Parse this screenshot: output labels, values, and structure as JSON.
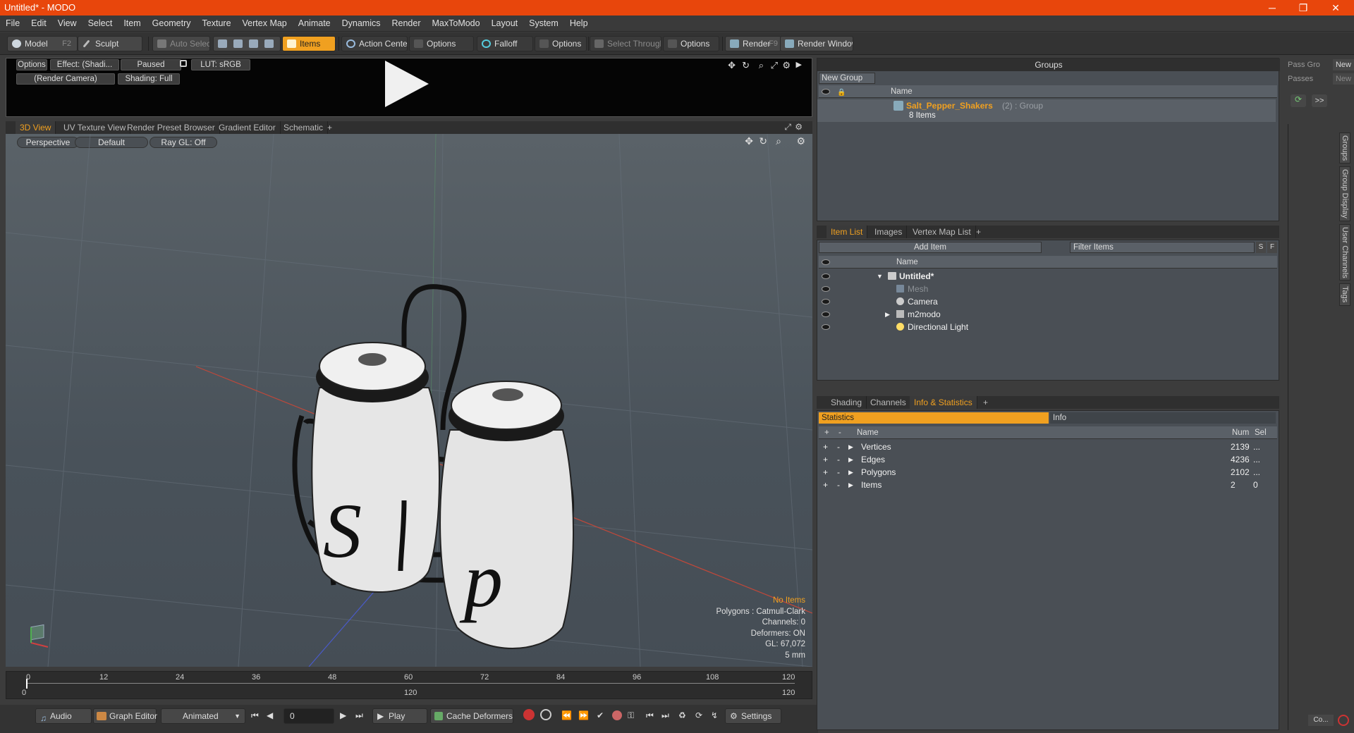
{
  "window": {
    "title": "Untitled* - MODO",
    "min": "─",
    "max": "❐",
    "close": "✕"
  },
  "menu": [
    "File",
    "Edit",
    "View",
    "Select",
    "Item",
    "Geometry",
    "Texture",
    "Vertex Map",
    "Animate",
    "Dynamics",
    "Render",
    "MaxToModo",
    "Layout",
    "System",
    "Help"
  ],
  "toolbar": {
    "model": "Model",
    "model_key": "F2",
    "sculpt": "Sculpt",
    "auto_select": "Auto Select",
    "items": "Items",
    "action_center": "Action Center",
    "options1": "Options",
    "falloff": "Falloff",
    "options2": "Options",
    "select_through": "Select Through",
    "options3": "Options",
    "render": "Render",
    "render_key": "F9",
    "render_window": "Render Window"
  },
  "preview": {
    "options": "Options",
    "effect": "Effect: (Shadi...",
    "paused": "Paused",
    "lut": "LUT: sRGB",
    "camera": "(Render Camera)",
    "shading": "Shading: Full"
  },
  "view_tabs": [
    "3D View",
    "UV Texture View",
    "Render Preset Browser",
    "Gradient Editor",
    "Schematic",
    "+"
  ],
  "viewport": {
    "perspective": "Perspective",
    "default": "Default",
    "raygl": "Ray GL: Off",
    "info": {
      "no_items": "No Items",
      "polygons": "Polygons : Catmull-Clark",
      "channels": "Channels: 0",
      "deformers": "Deformers: ON",
      "gl": "GL: 67,072",
      "unit": "5 mm"
    },
    "shaker_s": "S",
    "shaker_p": "p"
  },
  "timeline": {
    "ticks": [
      "0",
      "12",
      "24",
      "36",
      "48",
      "60",
      "72",
      "84",
      "96",
      "108",
      "120"
    ],
    "sub_ticks": [
      "0",
      "120",
      "120"
    ]
  },
  "transport": {
    "audio": "Audio",
    "graph_editor": "Graph Editor",
    "animated": "Animated",
    "frame": "0",
    "play": "Play",
    "cache": "Cache Deformers",
    "settings": "Settings"
  },
  "groups": {
    "title": "Groups",
    "new_group": "New Group",
    "name_col": "Name",
    "item": "Salt_Pepper_Shakers",
    "item_meta": "(2) : Group",
    "item_count": "8 Items"
  },
  "pass": {
    "pass_gro": "Pass Gro",
    "new1": "New",
    "passes": "Passes",
    "new2": "New",
    "more": ">>"
  },
  "item_list": {
    "tabs": [
      "Item List",
      "Images",
      "Vertex Map List",
      "+"
    ],
    "add_item": "Add Item",
    "filter": "Filter Items",
    "s": "S",
    "f": "F",
    "name_col": "Name",
    "rows": [
      {
        "label": "Untitled*"
      },
      {
        "label": "Mesh"
      },
      {
        "label": "Camera"
      },
      {
        "label": "m2modo"
      },
      {
        "label": "Directional Light"
      }
    ]
  },
  "stats": {
    "tabs": [
      "Shading",
      "Channels",
      "Info & Statistics",
      "+"
    ],
    "statistics": "Statistics",
    "info": "Info",
    "name_col": "Name",
    "num_col": "Num",
    "sel_col": "Sel",
    "rows": [
      {
        "name": "Vertices",
        "num": "2139",
        "sel": "..."
      },
      {
        "name": "Edges",
        "num": "4236",
        "sel": "..."
      },
      {
        "name": "Polygons",
        "num": "2102",
        "sel": "..."
      },
      {
        "name": "Items",
        "num": "2",
        "sel": "0"
      }
    ]
  },
  "side_tabs": [
    "Groups",
    "Group Display",
    "User Channels",
    "Tags"
  ],
  "bottom_right": "Co..."
}
